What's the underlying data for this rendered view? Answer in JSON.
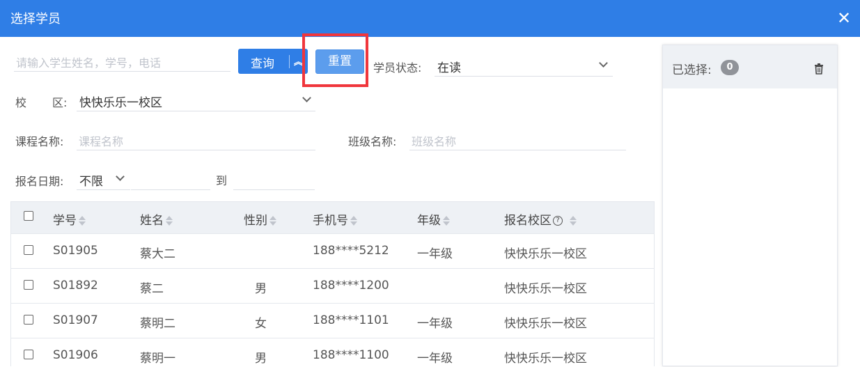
{
  "dialog": {
    "title": "选择学员",
    "close_glyph": "✕"
  },
  "search": {
    "keyword_placeholder": "请输入学生姓名，学号，电话",
    "query_label": "查询",
    "expand_glyph": "︽",
    "reset_label": "重置",
    "status_label": "学员状态:",
    "status_value": "在读",
    "campus_label_1": "校",
    "campus_label_2": "区:",
    "campus_value": "快快乐乐一校区",
    "course_label": "课程名称:",
    "course_placeholder": "课程名称",
    "class_label": "班级名称:",
    "class_placeholder": "班级名称",
    "date_label": "报名日期:",
    "date_range_value": "不限",
    "date_to": "到"
  },
  "table": {
    "columns": [
      "学号",
      "姓名",
      "性别",
      "手机号",
      "年级",
      "报名校区"
    ],
    "help_glyph": "?",
    "rows": [
      {
        "id": "S01905",
        "name": "蔡大二",
        "gender": "",
        "phone": "188****5212",
        "grade": "一年级",
        "campus": "快快乐乐一校区"
      },
      {
        "id": "S01892",
        "name": "蔡二",
        "gender": "男",
        "phone": "188****1200",
        "grade": "",
        "campus": "快快乐乐一校区"
      },
      {
        "id": "S01907",
        "name": "蔡明二",
        "gender": "女",
        "phone": "188****1101",
        "grade": "一年级",
        "campus": "快快乐乐一校区"
      },
      {
        "id": "S01906",
        "name": "蔡明一",
        "gender": "男",
        "phone": "188****1100",
        "grade": "一年级",
        "campus": "快快乐乐一校区"
      }
    ]
  },
  "selected_panel": {
    "label": "已选择:",
    "count": "0"
  },
  "colors": {
    "primary": "#2f7ee6",
    "reset_button": "#5c9ded",
    "highlight": "#f0363c",
    "header_bg": "#eef1f5"
  }
}
